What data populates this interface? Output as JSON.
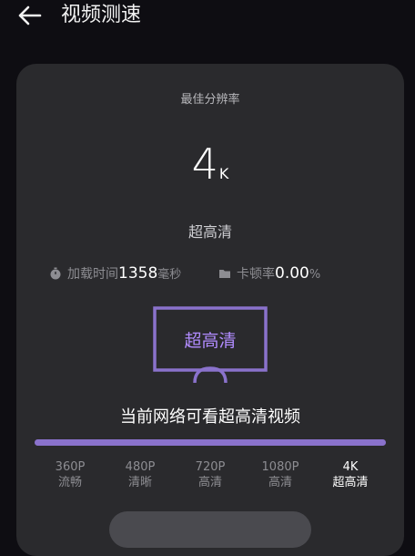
{
  "header": {
    "title": "视频测速"
  },
  "result": {
    "best_label": "最佳分辨率",
    "resolution_value": "4",
    "resolution_unit": "K",
    "quality": "超高清"
  },
  "stats": {
    "load_time": {
      "label": "加载时间",
      "value": "1358",
      "unit": "毫秒"
    },
    "stutter": {
      "label": "卡顿率",
      "value": "0.00",
      "unit": "%"
    }
  },
  "tv_label": "超高清",
  "message": "当前网络可看超高清视频",
  "progress": 1.0,
  "levels": [
    {
      "res": "360P",
      "name": "流畅"
    },
    {
      "res": "480P",
      "name": "清晰"
    },
    {
      "res": "720P",
      "name": "高清"
    },
    {
      "res": "1080P",
      "name": "高清"
    },
    {
      "res": "4K",
      "name": "超高清"
    }
  ],
  "active_level": 4,
  "colors": {
    "accent": "#b18cff",
    "bar": "#8a72cc",
    "card": "#2a2a2d",
    "background": "#0e0d12"
  },
  "icons": {
    "back": "arrow-left-icon",
    "timer": "stopwatch-icon",
    "stutter": "folder-icon"
  }
}
